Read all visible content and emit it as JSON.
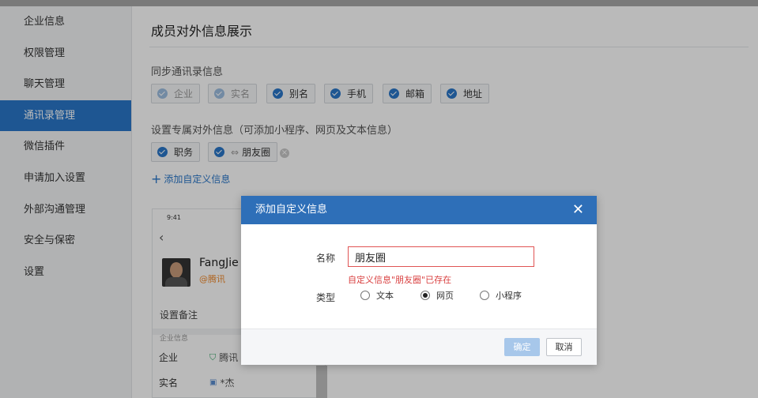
{
  "sidebar": {
    "items": [
      {
        "label": "企业信息"
      },
      {
        "label": "权限管理"
      },
      {
        "label": "聊天管理"
      },
      {
        "label": "通讯录管理"
      },
      {
        "label": "微信插件"
      },
      {
        "label": "申请加入设置"
      },
      {
        "label": "外部沟通管理"
      },
      {
        "label": "安全与保密"
      },
      {
        "label": "设置"
      }
    ],
    "active_index": 3
  },
  "main": {
    "title": "成员对外信息展示",
    "sync_section": {
      "label": "同步通讯录信息",
      "tags": [
        "企业",
        "实名",
        "别名",
        "手机",
        "邮箱",
        "地址"
      ]
    },
    "custom_section": {
      "label": "设置专属对外信息（可添加小程序、网页及文本信息）",
      "tags": [
        "职务",
        "朋友圈"
      ],
      "add_label": "添加自定义信息"
    },
    "preview": {
      "time": "9:41",
      "name": "FangJie",
      "corp": "@腾讯",
      "note_label": "设置备注",
      "section_label": "企业信息",
      "rows": [
        {
          "label": "企业",
          "value": "腾讯"
        },
        {
          "label": "实名",
          "value": "*杰"
        }
      ]
    }
  },
  "dialog": {
    "title": "添加自定义信息",
    "name_label": "名称",
    "name_value": "朋友圈",
    "error": "自定义信息\"朋友圈\"已存在",
    "type_label": "类型",
    "type_options": [
      "文本",
      "网页",
      "小程序"
    ],
    "type_selected": 1,
    "ok_label": "确定",
    "cancel_label": "取消"
  },
  "colors": {
    "accent": "#2a77c9",
    "dialog_header": "#2e6fb8",
    "error": "#d94040",
    "corp_text": "#f08a2c"
  }
}
